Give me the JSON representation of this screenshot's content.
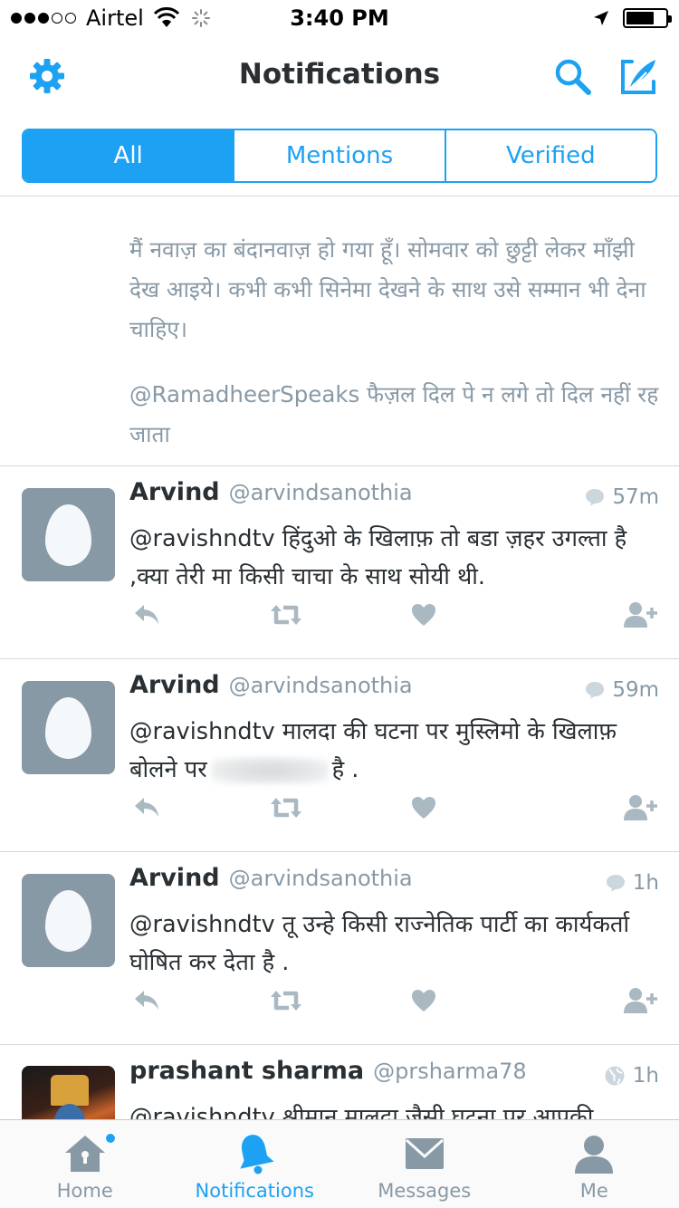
{
  "status_bar": {
    "carrier": "Airtel",
    "time": "3:40 PM",
    "signal_bars_filled": 3,
    "signal_bars_total": 5
  },
  "nav": {
    "title": "Notifications",
    "left_icon": "gear-icon",
    "right_icons": [
      "search-icon",
      "compose-tweet-icon"
    ]
  },
  "segments": [
    {
      "label": "All",
      "active": true
    },
    {
      "label": "Mentions",
      "active": false
    },
    {
      "label": "Verified",
      "active": false
    }
  ],
  "quoted": {
    "text": "मैं नवाज़ का बंदानवाज़ हो गया हूँ। सोमवार को छुट्टी लेकर माँझी देख आइये। कभी कभी सिनेमा देखने के साथ उसे सम्मान भी देना चाहिए।",
    "reply": "@RamadheerSpeaks फैज़ल दिल पे न लगे तो दिल नहीं रह जाता"
  },
  "tweets": [
    {
      "name": "Arvind",
      "handle": "@arvindsanothia",
      "time": "57m",
      "time_icon": "reply-bubble-icon",
      "text": "@ravishndtv   हिंदुओ के खिलाफ़ तो बडा ज़हर उगल्ता है ,क्या तेरी मा किसी चाचा के साथ सोयी थी."
    },
    {
      "name": "Arvind",
      "handle": "@arvindsanothia",
      "time": "59m",
      "time_icon": "reply-bubble-icon",
      "text_before": "@ravishndtv  मालदा की घटना पर मुस्लिमो के खिलाफ़ बोलने पर",
      "text_after": "है ."
    },
    {
      "name": "Arvind",
      "handle": "@arvindsanothia",
      "time": "1h",
      "time_icon": "reply-bubble-icon",
      "text": "@ravishndtv  तू उन्हे किसी राज्नेतिक पार्टी का कार्यकर्ता घोषित कर देता है ."
    },
    {
      "name": "prashant sharma",
      "handle": "@prsharma78",
      "time": "1h",
      "time_icon": "globe-icon",
      "text": "@ravishndtv श्रीमान मालदा जैसी घटना पर आपकी"
    }
  ],
  "tab_bar": [
    {
      "label": "Home",
      "icon": "home-icon",
      "active": false,
      "badge": true
    },
    {
      "label": "Notifications",
      "icon": "bell-icon",
      "active": true,
      "badge": false
    },
    {
      "label": "Messages",
      "icon": "envelope-icon",
      "active": false,
      "badge": false
    },
    {
      "label": "Me",
      "icon": "person-icon",
      "active": false,
      "badge": false
    }
  ],
  "colors": {
    "accent": "#1da1f2",
    "muted": "#8899a6",
    "text": "#292f33",
    "avatar_bg": "#8899a6"
  }
}
